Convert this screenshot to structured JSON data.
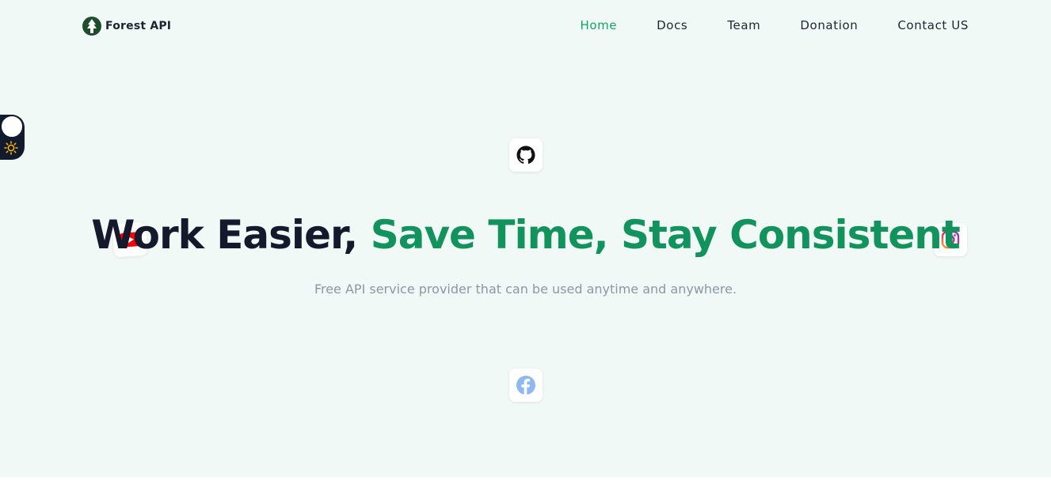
{
  "brand": {
    "name": "Forest API",
    "icon": "pine-tree-icon",
    "color": "#1f4d2b"
  },
  "nav": {
    "items": [
      {
        "label": "Home",
        "active": true
      },
      {
        "label": "Docs",
        "active": false
      },
      {
        "label": "Team",
        "active": false
      },
      {
        "label": "Donation",
        "active": false
      },
      {
        "label": "Contact US",
        "active": false
      }
    ],
    "active_color": "#10a569"
  },
  "theme_toggle": {
    "icon": "sun-icon",
    "mode": "light"
  },
  "hero": {
    "headline_dark": "Work Easier,",
    "headline_green": "Save Time, Stay Consistent",
    "subtitle": "Free API service provider that can be used anytime and anywhere.",
    "background": "#f1f9f6",
    "accent": "#12925d"
  },
  "social": {
    "icons": [
      "github-icon",
      "youtube-icon",
      "instagram-icon",
      "facebook-icon"
    ]
  }
}
